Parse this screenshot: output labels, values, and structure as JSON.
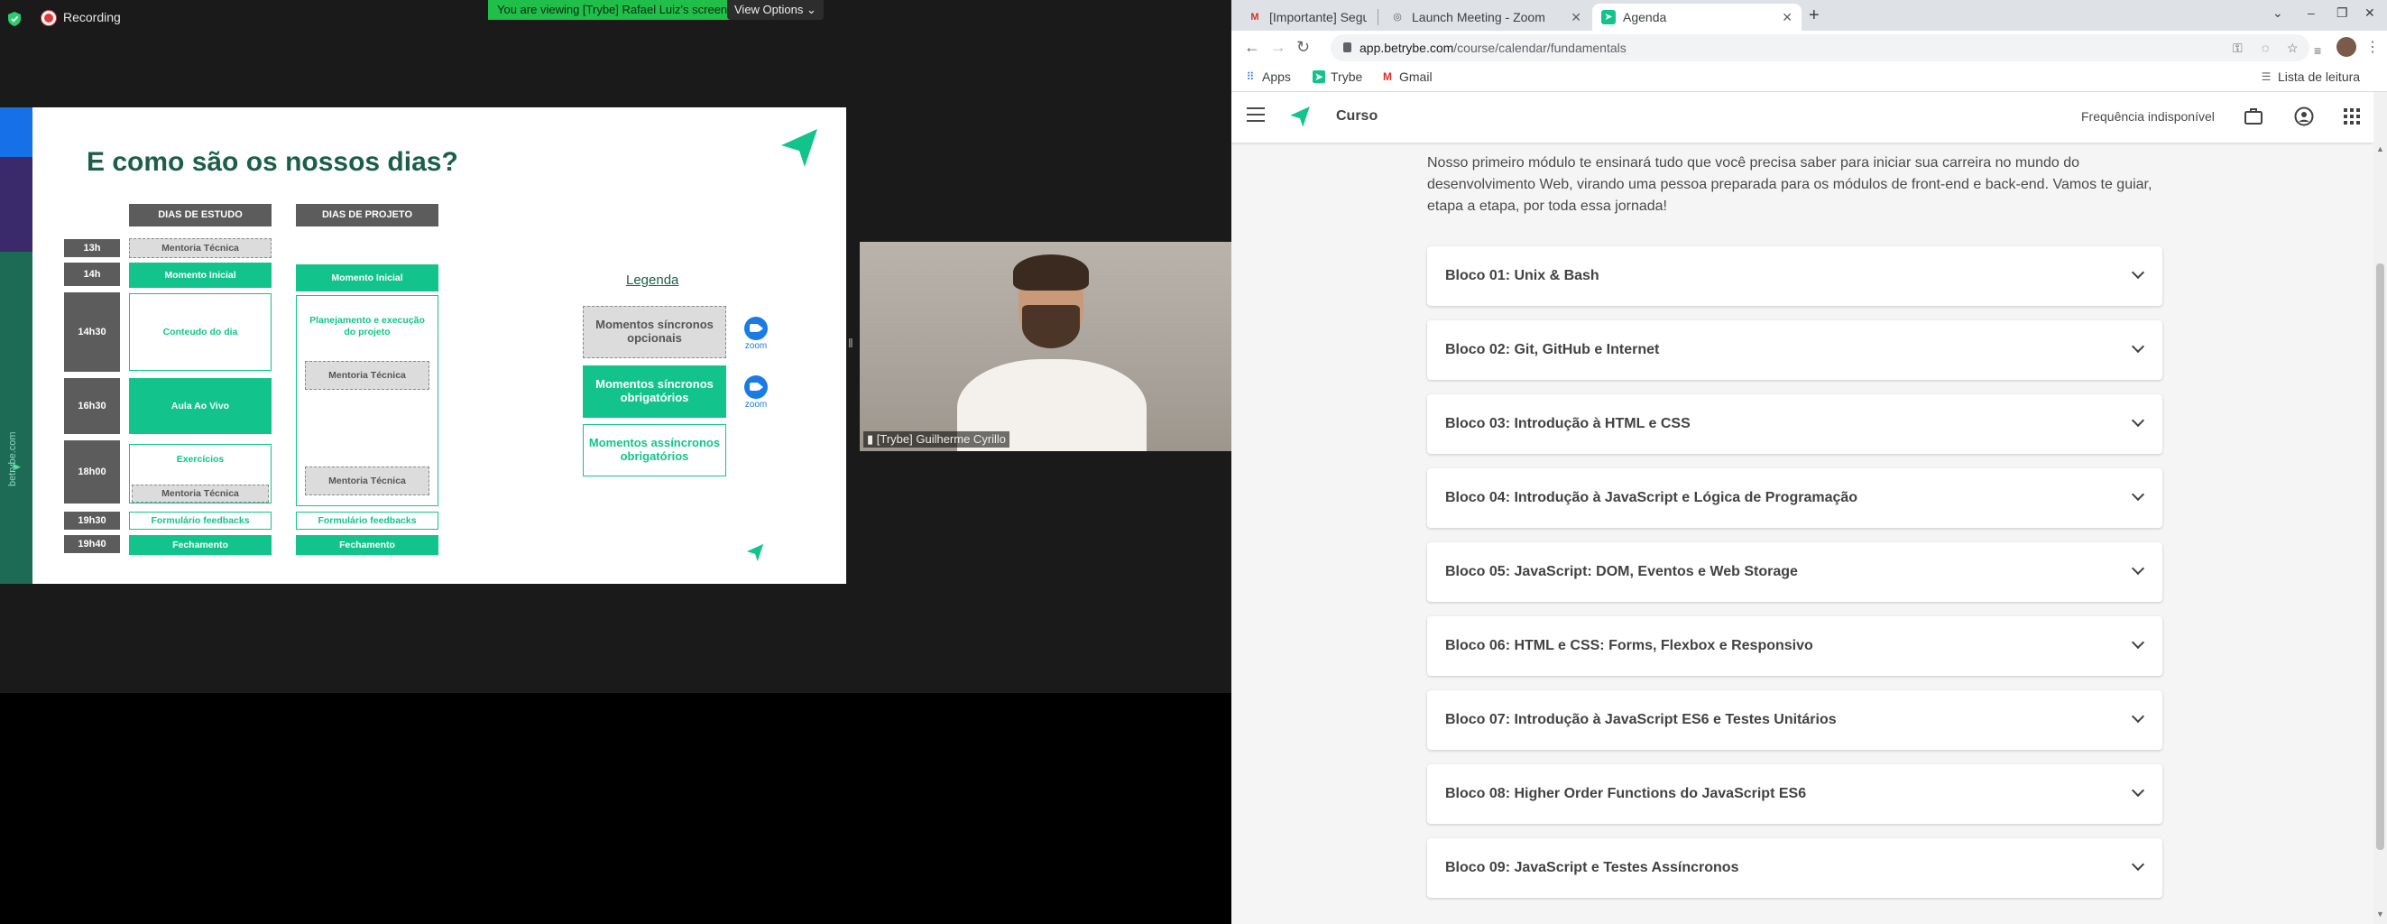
{
  "zoom": {
    "recording_label": "Recording",
    "viewing_banner": "You are viewing [Trybe] Rafael Luiz's screen",
    "view_options": "View Options",
    "participant_name": "[Trybe] Guilherme Cyrillo"
  },
  "slide": {
    "title": "E como são os nossos dias?",
    "side_text": "betrybe.com",
    "col_study": "DIAS DE ESTUDO",
    "col_project": "DIAS DE PROJETO",
    "times": [
      "13h",
      "14h",
      "14h30",
      "16h30",
      "18h00",
      "19h30",
      "19h40"
    ],
    "study": {
      "mentoria_13": "Mentoria Técnica",
      "momento_inicial": "Momento Inicial",
      "conteudo": "Conteudo do dia",
      "aula": "Aula Ao Vivo",
      "exercicios": "Exercícios",
      "mentoria_18": "Mentoria Técnica",
      "formulario": "Formulário feedbacks",
      "fechamento": "Fechamento"
    },
    "project": {
      "momento_inicial": "Momento Inicial",
      "planejamento": "Planejamento e execução do projeto",
      "mentoria_a": "Mentoria Técnica",
      "mentoria_b": "Mentoria Técnica",
      "formulario": "Formulário feedbacks",
      "fechamento": "Fechamento"
    },
    "legend": {
      "title": "Legenda",
      "opcionais": "Momentos síncronos opcionais",
      "obrigatorios": "Momentos síncronos obrigatórios",
      "assincronos": "Momentos assíncronos obrigatórios",
      "zoom_label": "zoom"
    }
  },
  "browser": {
    "tabs": [
      {
        "title": "[Importante] Segunda é d",
        "icon": "gmail-icon"
      },
      {
        "title": "Launch Meeting - Zoom",
        "icon": "globe-icon"
      },
      {
        "title": "Agenda",
        "icon": "trybe-icon"
      }
    ],
    "url_host": "app.betrybe.com",
    "url_path": "/course/calendar/fundamentals",
    "bookmarks": [
      "Apps",
      "Trybe",
      "Gmail"
    ],
    "reading_list": "Lista de leitura"
  },
  "app": {
    "title": "Curso",
    "frequency": "Frequência indisponível",
    "intro": "Nosso primeiro módulo te ensinará tudo que você precisa saber para iniciar sua carreira no mundo do desenvolvimento Web, virando uma pessoa preparada para os módulos de front-end e back-end. Vamos te guiar, etapa a etapa, por toda essa jornada!",
    "blocks": [
      "Bloco 01: Unix & Bash",
      "Bloco 02: Git, GitHub e Internet",
      "Bloco 03: Introdução à HTML e CSS",
      "Bloco 04: Introdução à JavaScript e Lógica de Programação",
      "Bloco 05: JavaScript: DOM, Eventos e Web Storage",
      "Bloco 06: HTML e CSS: Forms, Flexbox e Responsivo",
      "Bloco 07: Introdução à JavaScript ES6 e Testes Unitários",
      "Bloco 08: Higher Order Functions do JavaScript ES6",
      "Bloco 09: JavaScript e Testes Assíncronos"
    ]
  },
  "colors": {
    "trybe_green": "#12c48b",
    "zoom_blue": "#1a7be6",
    "viewing_green": "#1fbf4a"
  }
}
